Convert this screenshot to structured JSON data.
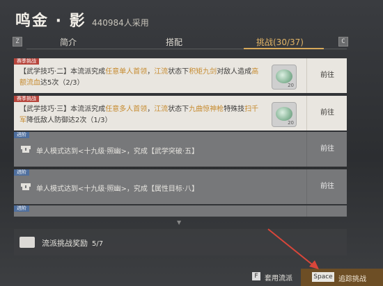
{
  "header": {
    "title": "鸣金 · 影",
    "adoption": "440984人采用"
  },
  "tabs": {
    "left_key": "Z",
    "right_key": "C",
    "items": [
      {
        "label": "简介"
      },
      {
        "label": "搭配"
      },
      {
        "label": "挑战(30/37)"
      }
    ]
  },
  "challenges": [
    {
      "tag": "赛季挑战",
      "segments": [
        "【武学技巧·二】本流派究成",
        "任意单人首领",
        "，",
        "江流",
        "状态下",
        "积矩九剑",
        "对敌人造成",
        "高额流血",
        "达5次（2/3）"
      ],
      "reward_qty": "20",
      "action": "前往"
    },
    {
      "tag": "赛季挑战",
      "segments": [
        "【武学技巧·三】本流派究成",
        "任意多人首领",
        "，",
        "江流",
        "状态下",
        "九曲惊神枪",
        "特殊技",
        "扫千军",
        "降低敌人防御达2次（1/3）"
      ],
      "reward_qty": "20",
      "action": "前往"
    },
    {
      "tag": "进阶",
      "text": "单人模式达到<十九级·照幽>，究成【武学突破·五】",
      "action": "前往"
    },
    {
      "tag": "进阶",
      "text": "单人模式达到<十九级·照幽>，究成【属性目标·八】",
      "action": "前往"
    },
    {
      "tag": "进阶",
      "text": "",
      "action": "前往"
    }
  ],
  "reward": {
    "label": "流派挑战奖励",
    "count": "5/7"
  },
  "footer": {
    "apply_key": "F",
    "apply_label": "套用流派",
    "track_key": "Space",
    "track_label": "追踪挑战"
  },
  "colors": {
    "accent": "#d8a95a",
    "highlight": "#c68b2f",
    "season_tag": "#b7453c",
    "advance_tag": "#4f6f9e",
    "arrow": "#d9463a"
  }
}
